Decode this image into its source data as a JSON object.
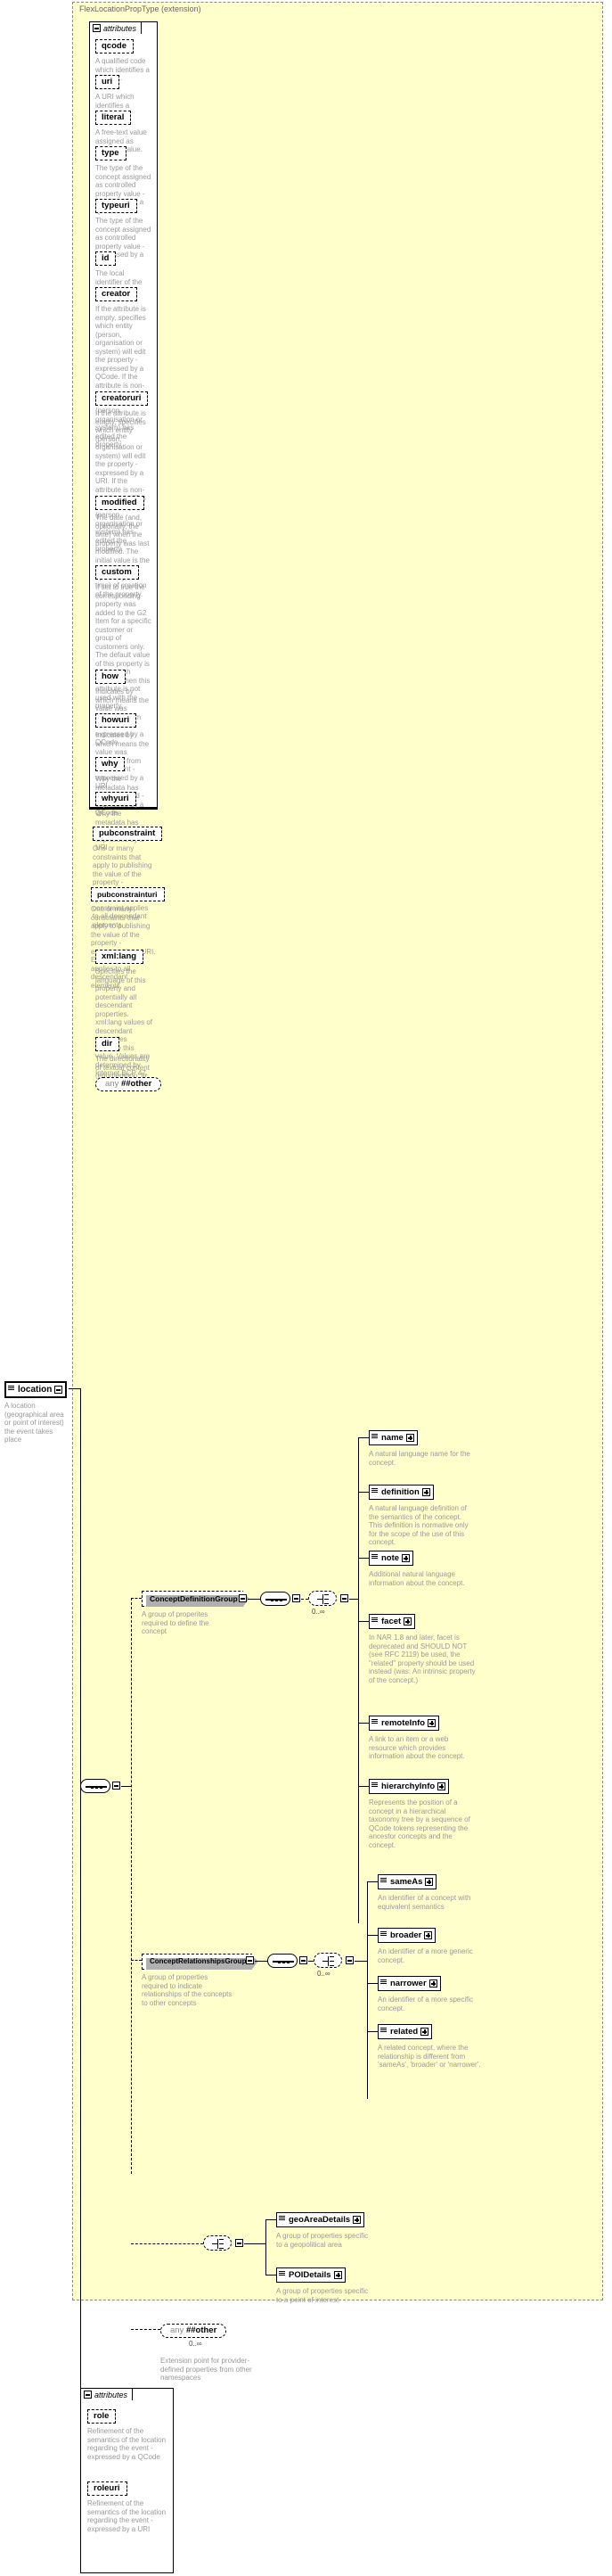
{
  "diagram": {
    "type": "xsd-schema-documentation",
    "extension_label": "FlexLocationPropType (extension)",
    "attributes_label": "attributes",
    "any_label_prefix": "any",
    "any_label_name": "##other",
    "cardinality_unbounded": "0..∞"
  },
  "root_element": {
    "name": "location",
    "description": "A location (geographical area or point of interest) the event takes place"
  },
  "attributes": [
    {
      "name": "qcode",
      "desc": "A qualified code which identifies a concept."
    },
    {
      "name": "uri",
      "desc": "A URI which identifies a concept."
    },
    {
      "name": "literal",
      "desc": "A free-text value assigned as property value."
    },
    {
      "name": "type",
      "desc": "The type of the concept assigned as controlled property value - expressed by a QCode"
    },
    {
      "name": "typeuri",
      "desc": "The type of the concept assigned as controlled property value - expressed by a URI"
    },
    {
      "name": "id",
      "desc": "The local identifier of the property."
    },
    {
      "name": "creator",
      "desc": "If the attribute is empty, specifies which entity (person, organisation or system) will edit the property - expressed by a QCode. If the attribute is non-empty, specifies which entity (person, organisation or system) has edited the property."
    },
    {
      "name": "creatoruri",
      "desc": "If the attribute is empty, specifies which entity (person, organisation or system) will edit the property - expressed by a URI. If the attribute is non-empty, specifies which entity (person, organisation or system) has edited the property."
    },
    {
      "name": "modified",
      "desc": "The date (and, optionally, the time) when the property was last modified. The initial value is the date (and, optionally, the time) of creation of the property."
    },
    {
      "name": "custom",
      "desc": "If set to true the corresponding property was added to the G2 Item for a specific customer or group of customers only. The default value of this property is false which applies when this attribute is not used with the property."
    },
    {
      "name": "how",
      "desc": "Indicates by which means the value was extracted from the content - expressed by a QCode"
    },
    {
      "name": "howuri",
      "desc": "Indicates by which means the value was extracted from the content - expressed by a URI"
    },
    {
      "name": "why",
      "desc": "Why the metadata has been included - expressed by a QCode"
    },
    {
      "name": "whyuri",
      "desc": "Why the metadata has been included - expressed by a URI"
    },
    {
      "name": "pubconstraint",
      "desc": "One or many constraints that apply to publishing the value of the property - expressed by a QCode. Each constraint applies to all descendant elements."
    },
    {
      "name": "pubconstrainturi",
      "desc": "One or many constraints that apply to publishing the value of the property - expressed by a URI. Each constraint applies to all descendant elements."
    },
    {
      "name": "xml:lang",
      "desc": "Specifies the language of this property and potentially all descendant properties. xml:lang values of descendant properties override this value. Values are determined by Internet BCP 47."
    },
    {
      "name": "dir",
      "desc": "The directionality of textual content (enumeration: ltr, rtl)"
    }
  ],
  "any_extension_top": {
    "prefix": "any",
    "name": "##other"
  },
  "groups": [
    {
      "name": "ConceptDefinitionGroup",
      "desc": "A group of properites required to define the concept",
      "cardinality": "0..∞",
      "children": [
        {
          "name": "name",
          "desc": "A natural language name for the concept."
        },
        {
          "name": "definition",
          "desc": "A natural language definition of the semantics of the concept. This definition is normative only for the scope of the use of this concept."
        },
        {
          "name": "note",
          "desc": "Additional natural language information about the concept."
        },
        {
          "name": "facet",
          "desc": "In NAR 1.8 and later, facet is deprecated and SHOULD NOT (see RFC 2119) be used, the \"related\" property should be used instead (was: An intrinsic property of the concept.)"
        },
        {
          "name": "remoteInfo",
          "desc": "A link to an item or a web resource which provides information about the concept."
        },
        {
          "name": "hierarchyInfo",
          "desc": "Represents the position of a concept in a hierarchical taxonomy tree by a sequence of QCode tokens representing the ancestor concepts and the concept."
        }
      ]
    },
    {
      "name": "ConceptRelationshipsGroup",
      "desc": "A group of properties required to indicate relationships of the concepts to other concepts",
      "cardinality": "0..∞",
      "children": [
        {
          "name": "sameAs",
          "desc": "An identifier of a concept with equivalent semantics"
        },
        {
          "name": "broader",
          "desc": "An identifier of a more generic concept."
        },
        {
          "name": "narrower",
          "desc": "An identifier of a more specific concept."
        },
        {
          "name": "related",
          "desc": "A related concept, where the relationship is different from 'sameAs', 'broader' or 'narrower'."
        }
      ]
    }
  ],
  "details_choice": {
    "children": [
      {
        "name": "geoAreaDetails",
        "desc": "A group of properties specific to a geopolitical area"
      },
      {
        "name": "POIDetails",
        "desc": "A group of properties specific to a point of interest"
      }
    ]
  },
  "any_extension_bottom": {
    "prefix": "any",
    "name": "##other",
    "cardinality": "0..∞",
    "desc": "Extension point for provider-defined properties from other namespaces"
  },
  "bottom_attributes": {
    "label": "attributes",
    "items": [
      {
        "name": "role",
        "desc": "Refinement of the semantics of the location regarding the event - expressed by a QCode"
      },
      {
        "name": "roleuri",
        "desc": "Refinement of the semantics of the location regarding the event - expressed by a URI"
      }
    ]
  },
  "colors": {
    "panel_background": "#ffffcc",
    "panel_border": "#888888",
    "box_border": "#000000",
    "description_text": "#999999",
    "shadow": "#b0b0b0",
    "page_background": "#ffffff"
  }
}
